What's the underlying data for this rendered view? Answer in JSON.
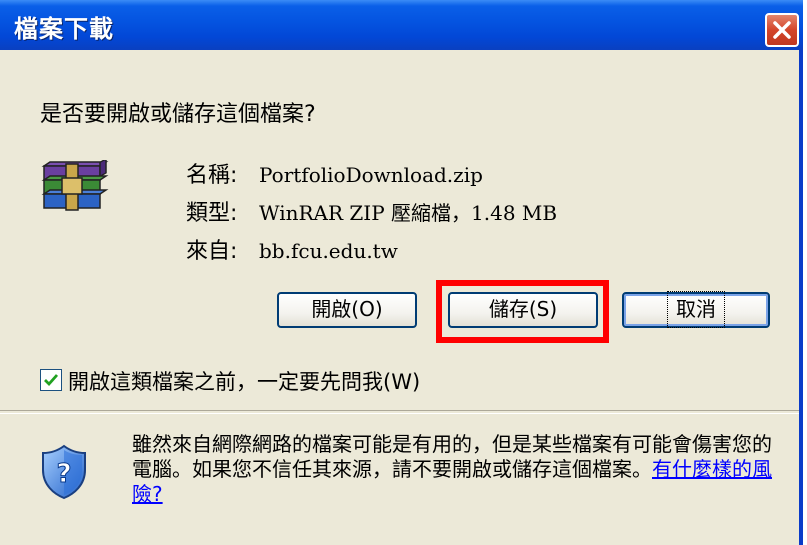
{
  "dialog": {
    "title": "檔案下載",
    "question": "是否要開啟或儲存這個檔案?"
  },
  "file_info": {
    "name_label": "名稱:",
    "name_value": "PortfolioDownload.zip",
    "type_label": "類型:",
    "type_value": "WinRAR ZIP 壓縮檔，1.48 MB",
    "from_label": "來自:",
    "from_value": "bb.fcu.edu.tw",
    "icon": "winrar-archive-icon"
  },
  "buttons": {
    "open": "開啟(O)",
    "save": "儲存(S)",
    "cancel": "取消"
  },
  "checkbox": {
    "checked": true,
    "label": "開啟這類檔案之前，一定要先問我(W)"
  },
  "warning": {
    "text": "雖然來自網際網路的檔案可能是有用的，但是某些檔案有可能會傷害您的電腦。如果您不信任其來源，請不要開啟或儲存這個檔案。",
    "link": "有什麼樣的風險?",
    "icon": "security-shield-icon"
  },
  "colors": {
    "title_bar": "#0453e0",
    "highlight": "#ff0000",
    "link": "#0000ff"
  }
}
